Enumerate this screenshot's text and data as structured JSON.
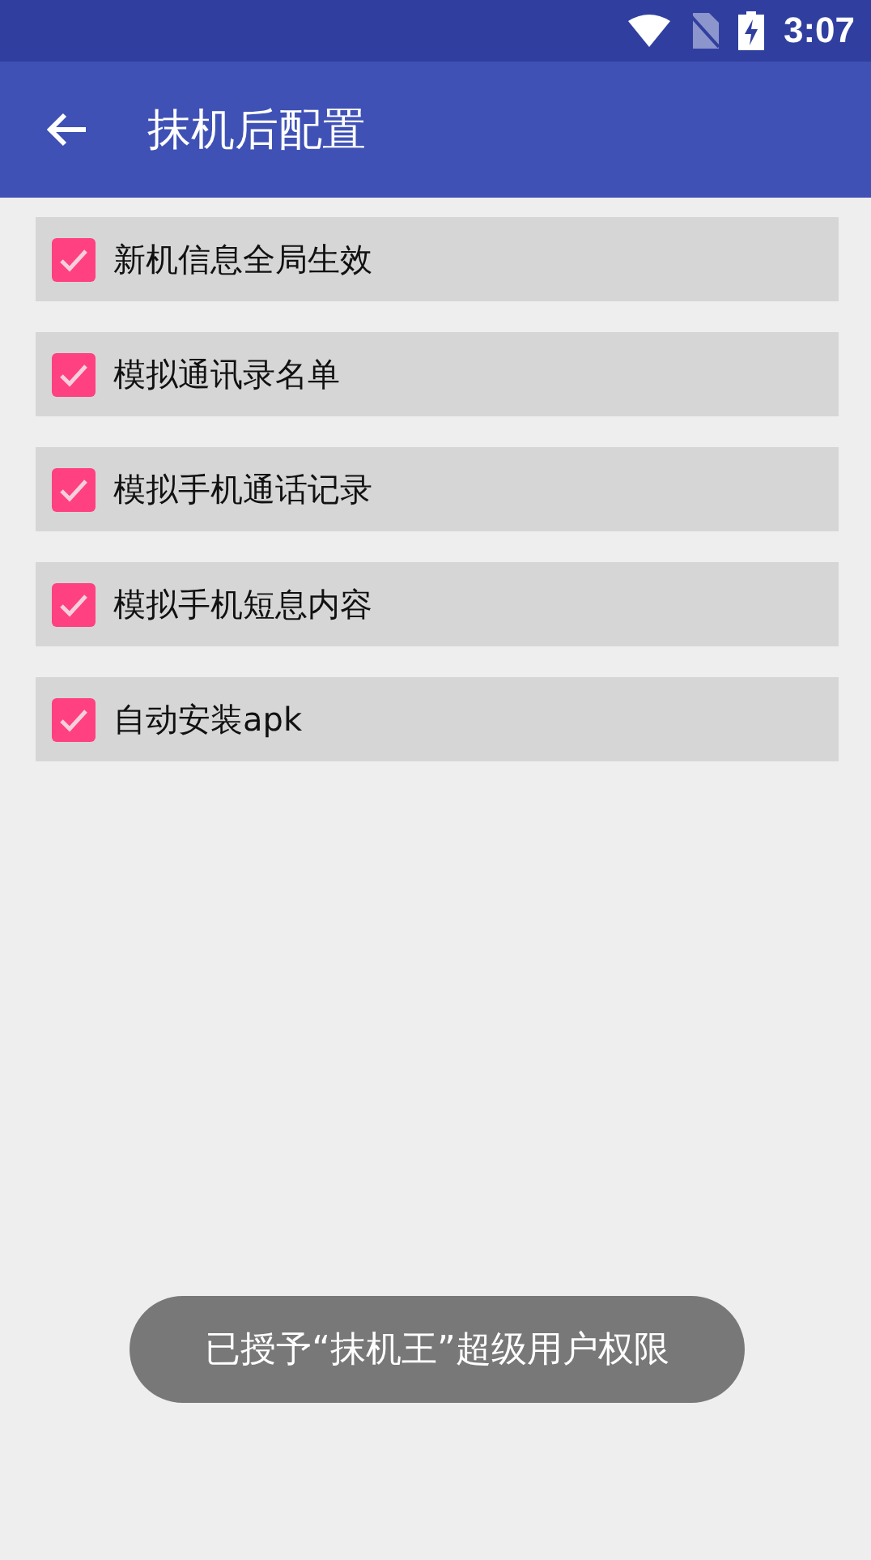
{
  "status_bar": {
    "time": "3:07"
  },
  "app_bar": {
    "title": "抹机后配置"
  },
  "options": [
    {
      "label": "新机信息全局生效",
      "checked": true
    },
    {
      "label": "模拟通讯录名单",
      "checked": true
    },
    {
      "label": "模拟手机通话记录",
      "checked": true
    },
    {
      "label": "模拟手机短息内容",
      "checked": true
    },
    {
      "label": "自动安装apk",
      "checked": true
    }
  ],
  "toast": {
    "text": "已授予“抹机王”超级用户权限"
  }
}
